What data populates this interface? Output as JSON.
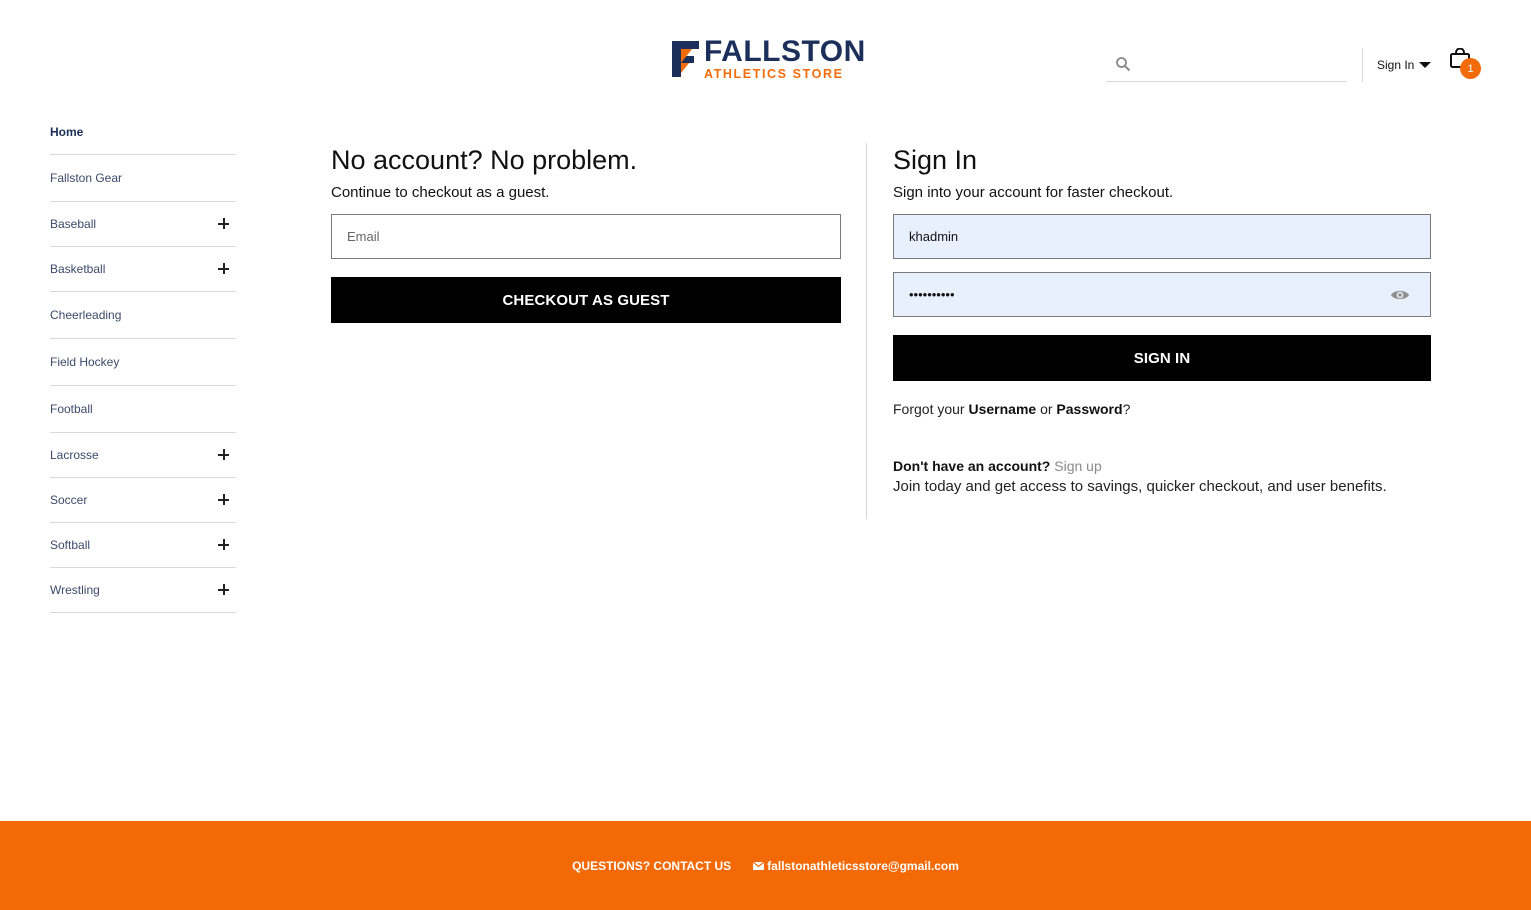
{
  "brand": {
    "name_line1": "FALLSTON",
    "name_line2": "ATHLETICS STORE",
    "colors": {
      "navy": "#1b2f5a",
      "orange": "#f36c0c"
    }
  },
  "header": {
    "search": {
      "placeholder": "",
      "icon": "search-icon"
    },
    "signin_label": "Sign In",
    "cart": {
      "icon": "shopping-bag-icon",
      "count": "1"
    }
  },
  "sidebar": {
    "items": [
      {
        "label": "Home",
        "expandable": false
      },
      {
        "label": "Fallston Gear",
        "expandable": false
      },
      {
        "label": "Baseball",
        "expandable": true
      },
      {
        "label": "Basketball",
        "expandable": true
      },
      {
        "label": "Cheerleading",
        "expandable": false
      },
      {
        "label": "Field Hockey",
        "expandable": false
      },
      {
        "label": "Football",
        "expandable": false
      },
      {
        "label": "Lacrosse",
        "expandable": true
      },
      {
        "label": "Soccer",
        "expandable": true
      },
      {
        "label": "Softball",
        "expandable": true
      },
      {
        "label": "Wrestling",
        "expandable": true
      }
    ]
  },
  "guest": {
    "title": "No account? No problem.",
    "subtitle": "Continue to checkout as a guest.",
    "email_placeholder": "Email",
    "button": "CHECKOUT AS GUEST"
  },
  "signin": {
    "title": "Sign In",
    "subtitle": "Sign into your account for faster checkout.",
    "username_value": "khadmin",
    "password_value": "••••••••••",
    "button": "SIGN IN",
    "forgot_prefix": "Forgot your ",
    "forgot_username": "Username",
    "forgot_or": " or ",
    "forgot_password": "Password",
    "forgot_suffix": "?",
    "account_question": "Don't have an account?",
    "signup_link": "Sign up",
    "join_text": "Join today and get access to savings, quicker checkout, and user benefits."
  },
  "footer": {
    "contact": "QUESTIONS? CONTACT US",
    "email": "fallstonathleticsstore@gmail.com",
    "background": "#f36905"
  }
}
